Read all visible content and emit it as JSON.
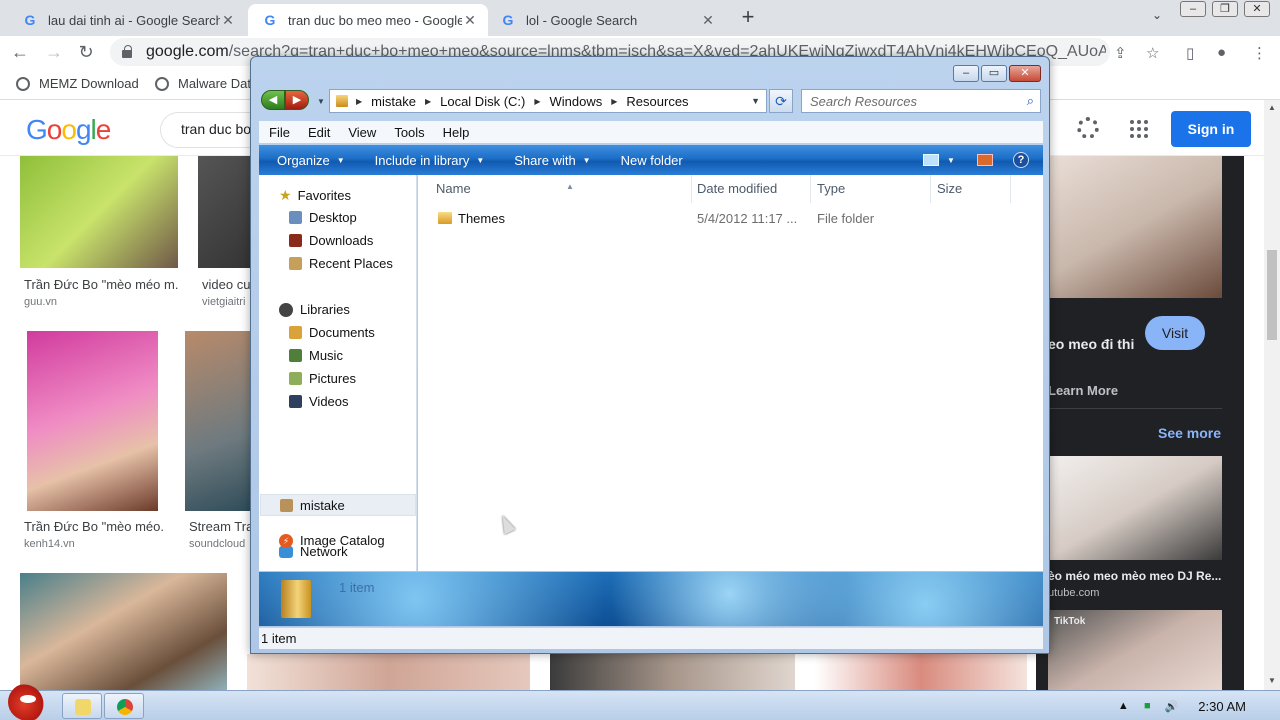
{
  "browser": {
    "tabs": [
      {
        "title": "lau dai tinh ai - Google Search",
        "active": false
      },
      {
        "title": "tran duc bo meo meo - Google",
        "active": true
      },
      {
        "title": "lol - Google Search",
        "active": false
      }
    ],
    "url_host": "google.com",
    "url_path": "/search?q=tran+duc+bo+meo+meo&source=lnms&tbm=isch&sa=X&ved=2ahUKEwiNqZiwxdT4AhVnj4kEHWibCEoQ_AUoAXoE...",
    "bookmarks": [
      "MEMZ Download",
      "Malware Dat"
    ]
  },
  "google": {
    "search_value": "tran duc bo",
    "signin_label": "Sign in",
    "results": [
      {
        "caption": "Trần Đức Bo \"mèo méo m...",
        "source": "guu.vn"
      },
      {
        "caption": "video cu",
        "source": "vietgiaitri"
      },
      {
        "caption": "Trần Đức Bo \"mèo méo...",
        "source": "kenh14.vn"
      },
      {
        "caption": "Stream Tra",
        "source": "soundcloud"
      }
    ],
    "panel": {
      "title": "eo meo đi thi",
      "visit_label": "Visit",
      "learn_more": "Learn More",
      "see_more": "See more",
      "video_title": "èo méo meo mèo meo DJ Re...",
      "video_source": "utube.com",
      "tiktok": "TikTok"
    }
  },
  "explorer": {
    "address": [
      "mistake",
      "Local Disk (C:)",
      "Windows",
      "Resources"
    ],
    "search_placeholder": "Search Resources",
    "menu": [
      "File",
      "Edit",
      "View",
      "Tools",
      "Help"
    ],
    "commands": [
      {
        "label": "Organize",
        "dropdown": true
      },
      {
        "label": "Include in library",
        "dropdown": true
      },
      {
        "label": "Share with",
        "dropdown": true
      },
      {
        "label": "New folder",
        "dropdown": false
      }
    ],
    "nav": {
      "favorites": "Favorites",
      "favorites_items": [
        "Desktop",
        "Downloads",
        "Recent Places"
      ],
      "libraries": "Libraries",
      "libraries_items": [
        "Documents",
        "Music",
        "Pictures",
        "Videos"
      ],
      "homegroup": "mistake",
      "network": "Network",
      "catalog": "Image Catalog"
    },
    "columns": [
      "Name",
      "Date modified",
      "Type",
      "Size"
    ],
    "files": [
      {
        "name": "Themes",
        "date": "5/4/2012 11:17 ...",
        "type": "File folder",
        "size": ""
      }
    ],
    "details_count": "1 item",
    "status": "1 item"
  },
  "taskbar": {
    "clock": "2:30 AM"
  },
  "colors": {
    "accent": "#1a73e8",
    "command_bar": "#1c6ec7",
    "panel_bg": "#202124"
  }
}
